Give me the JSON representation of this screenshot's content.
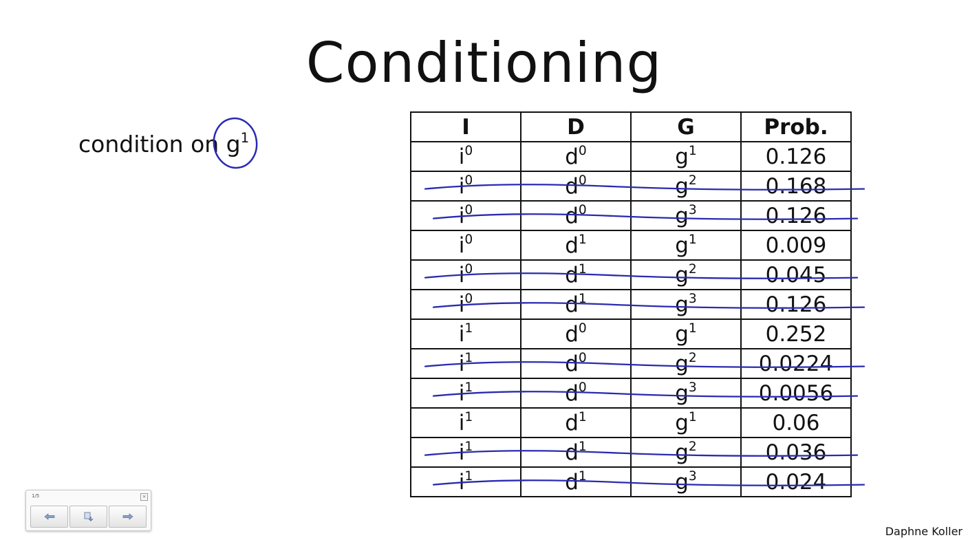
{
  "title": "Conditioning",
  "condition": {
    "text": "condition on ",
    "variable": "g",
    "superscript": "1"
  },
  "table": {
    "headers": [
      "I",
      "D",
      "G",
      "Prob."
    ],
    "rows": [
      {
        "i": "0",
        "d": "0",
        "g": "1",
        "prob": "0.126",
        "struck": false
      },
      {
        "i": "0",
        "d": "0",
        "g": "2",
        "prob": "0.168",
        "struck": true
      },
      {
        "i": "0",
        "d": "0",
        "g": "3",
        "prob": "0.126",
        "struck": true
      },
      {
        "i": "0",
        "d": "1",
        "g": "1",
        "prob": "0.009",
        "struck": false
      },
      {
        "i": "0",
        "d": "1",
        "g": "2",
        "prob": "0.045",
        "struck": true
      },
      {
        "i": "0",
        "d": "1",
        "g": "3",
        "prob": "0.126",
        "struck": true
      },
      {
        "i": "1",
        "d": "0",
        "g": "1",
        "prob": "0.252",
        "struck": false
      },
      {
        "i": "1",
        "d": "0",
        "g": "2",
        "prob": "0.0224",
        "struck": true
      },
      {
        "i": "1",
        "d": "0",
        "g": "3",
        "prob": "0.0056",
        "struck": true
      },
      {
        "i": "1",
        "d": "1",
        "g": "1",
        "prob": "0.06",
        "struck": false
      },
      {
        "i": "1",
        "d": "1",
        "g": "2",
        "prob": "0.036",
        "struck": true
      },
      {
        "i": "1",
        "d": "1",
        "g": "3",
        "prob": "0.024",
        "struck": true
      }
    ]
  },
  "author": "Daphne Koller",
  "player": {
    "counter": "1/5",
    "buttons": [
      "prev-arrow-icon",
      "slide-menu-icon",
      "next-arrow-icon"
    ]
  },
  "colors": {
    "ink": "#2a2ab0",
    "text": "#111111"
  }
}
